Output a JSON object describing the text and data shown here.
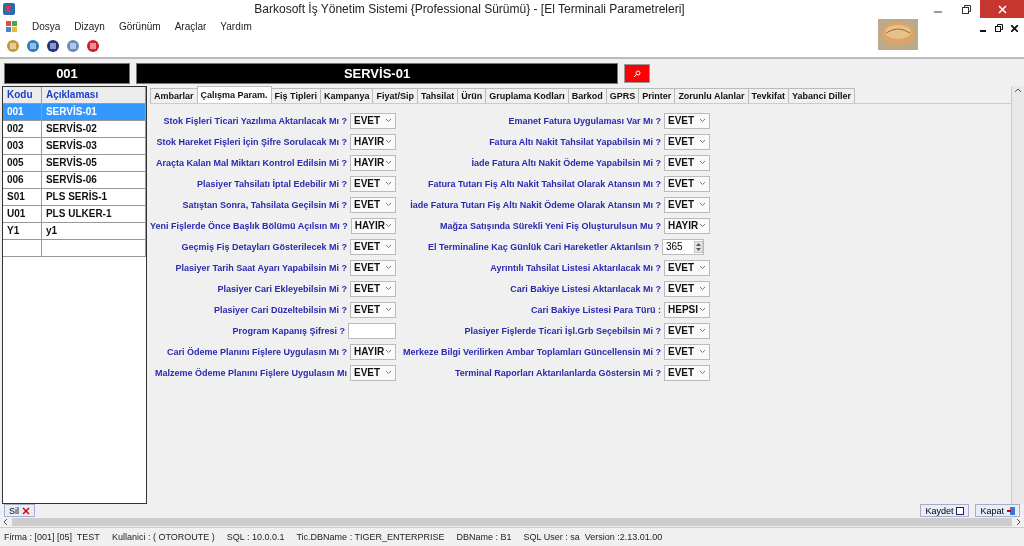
{
  "window": {
    "title": "Barkosoft İş Yönetim Sistemi {Professional Sürümü} - [El Terminali Parametreleri]"
  },
  "menu": [
    "Dosya",
    "Dizayn",
    "Görünüm",
    "Araçlar",
    "Yardım"
  ],
  "header": {
    "code": "001",
    "name": "SERVİS-01"
  },
  "table": {
    "columns": [
      "Kodu",
      "Açıklaması"
    ],
    "rows": [
      {
        "code": "001",
        "name": "SERVİS-01",
        "selected": true
      },
      {
        "code": "002",
        "name": "SERVİS-02",
        "selected": false
      },
      {
        "code": "003",
        "name": "SERVİS-03",
        "selected": false
      },
      {
        "code": "005",
        "name": "SERVİS-05",
        "selected": false
      },
      {
        "code": "006",
        "name": "SERVİS-06",
        "selected": false
      },
      {
        "code": "S01",
        "name": "PLS SERİS-1",
        "selected": false
      },
      {
        "code": "U01",
        "name": "PLS ULKER-1",
        "selected": false
      },
      {
        "code": "Y1",
        "name": "y1",
        "selected": false
      }
    ]
  },
  "tabs": [
    {
      "label": "Ambarlar",
      "selected": false
    },
    {
      "label": "Çalışma Param.",
      "selected": true
    },
    {
      "label": "Fiş Tipleri",
      "selected": false
    },
    {
      "label": "Kampanya",
      "selected": false
    },
    {
      "label": "Fiyat/Sip",
      "selected": false
    },
    {
      "label": "Tahsilat",
      "selected": false
    },
    {
      "label": "Ürün",
      "selected": false
    },
    {
      "label": "Gruplama Kodları",
      "selected": false
    },
    {
      "label": "Barkod",
      "selected": false
    },
    {
      "label": "GPRS",
      "selected": false
    },
    {
      "label": "Printer",
      "selected": false
    },
    {
      "label": "Zorunlu Alanlar",
      "selected": false
    },
    {
      "label": "Tevkifat",
      "selected": false
    },
    {
      "label": "Yabanci Diller",
      "selected": false
    }
  ],
  "left_params": [
    {
      "label": "Stok Fişleri Ticari Yazılıma Aktarılacak Mı ?",
      "kind": "select",
      "value": "EVET"
    },
    {
      "label": "Stok Hareket Fişleri İçin Şifre Sorulacak Mı ?",
      "kind": "select",
      "value": "HAYIR"
    },
    {
      "label": "Araçta Kalan Mal Miktarı Kontrol Edilsin Mi ?",
      "kind": "select",
      "value": "HAYIR"
    },
    {
      "label": "Plasiyer Tahsilatı İptal Edebilir Mi ?",
      "kind": "select",
      "value": "EVET"
    },
    {
      "label": "Satıştan Sonra, Tahsilata Geçilsin Mi ?",
      "kind": "select",
      "value": "EVET"
    },
    {
      "label": "Yeni Fişlerde Önce Başlık Bölümü Açılsın Mı ?",
      "kind": "select",
      "value": "HAYIR"
    },
    {
      "label": "Geçmiş Fiş Detayları Gösterilecek Mi ?",
      "kind": "select",
      "value": "EVET"
    },
    {
      "label": "Plasiyer Tarih Saat Ayarı Yapabilsin Mi ?",
      "kind": "select",
      "value": "EVET"
    },
    {
      "label": "Plasiyer Cari Ekleyebilsin Mi ?",
      "kind": "select",
      "value": "EVET"
    },
    {
      "label": "Plasiyer Cari Düzeltebilsin Mi ?",
      "kind": "select",
      "value": "EVET"
    },
    {
      "label": "Program Kapanış Şifresi ?",
      "kind": "text"
    },
    {
      "label": "Cari Ödeme Planını Fişlere Uygulasın Mı ?",
      "kind": "select",
      "value": "HAYIR"
    },
    {
      "label": "Malzeme Ödeme Planını Fişlere Uygulasın Mı",
      "kind": "select",
      "value": "EVET"
    }
  ],
  "right_params": [
    {
      "label": "Emanet Fatura Uygulaması Var Mı ?",
      "kind": "select",
      "value": "EVET"
    },
    {
      "label": "Fatura Altı Nakit Tahsilat Yapabilsin Mi ?",
      "kind": "select",
      "value": "EVET"
    },
    {
      "label": "İade Fatura Altı Nakit Ödeme Yapabilsin Mi ?",
      "kind": "select",
      "value": "EVET"
    },
    {
      "label": "Fatura Tutarı Fiş Altı Nakit Tahsilat Olarak Atansın Mı ?",
      "kind": "select",
      "value": "EVET"
    },
    {
      "label": "İade Fatura Tutarı Fiş Altı Nakit Ödeme Olarak Atansın Mı ?",
      "kind": "select",
      "value": "EVET"
    },
    {
      "label": "Mağza Satışında Sürekli Yeni Fiş Oluşturulsun Mu ?",
      "kind": "select",
      "value": "HAYIR"
    },
    {
      "label": "El Terminaline Kaç Günlük Cari Hareketler Aktarılsın ?",
      "kind": "spin",
      "value": "365"
    },
    {
      "label": "Ayrıntılı Tahsilat Listesi Aktarılacak Mı ?",
      "kind": "select",
      "value": "EVET"
    },
    {
      "label": "Cari Bakiye Listesi Aktarılacak Mı ?",
      "kind": "select",
      "value": "EVET"
    },
    {
      "label": "Cari Bakiye Listesi Para Türü :",
      "kind": "select",
      "value": "HEPSI"
    },
    {
      "label": "Plasiyer Fişlerde Ticari İşl.Grb Seçebilsin Mi ?",
      "kind": "select",
      "value": "EVET"
    },
    {
      "label": "Merkeze Bilgi Verilirken Ambar Toplamları Güncellensin Mi ?",
      "kind": "select",
      "value": "EVET"
    },
    {
      "label": "Terminal Raporları Aktarılanlarda Göstersin Mi ?",
      "kind": "select",
      "value": "EVET"
    }
  ],
  "buttons": {
    "delete": "Sil",
    "save": "Kaydet",
    "close": "Kapat"
  },
  "status_bar": [
    "Firma : [001] [05]  TEST",
    "Kullanici : ( OTOROUTE )",
    "SQL : 10.0.0.1",
    "Tic.DBName : TIGER_ENTERPRISE",
    "DBName : B1",
    "SQL User : sa  Version :2.13.01.00"
  ]
}
